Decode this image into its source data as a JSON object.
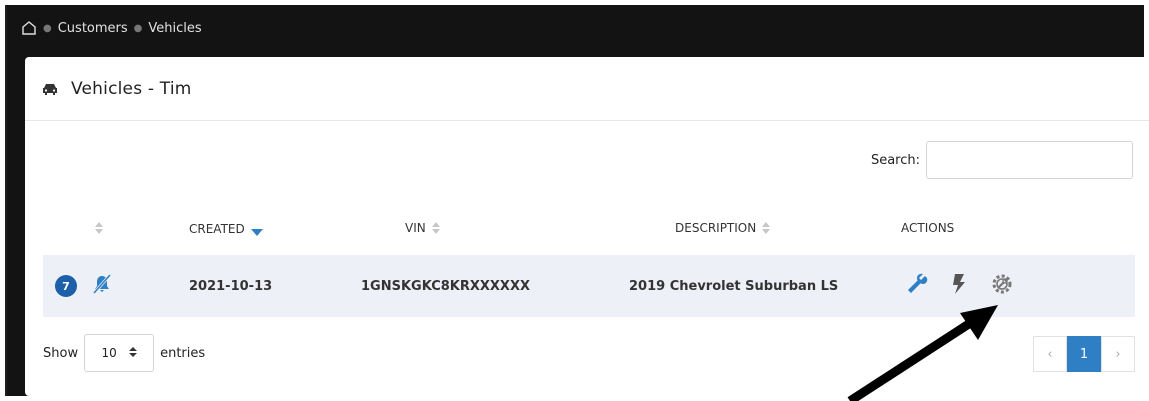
{
  "breadcrumb": {
    "icon": "home-icon",
    "items": [
      "Customers",
      "Vehicles"
    ]
  },
  "card": {
    "icon": "car-icon",
    "title": "Vehicles - Tim"
  },
  "search": {
    "label": "Search:",
    "value": "",
    "placeholder": ""
  },
  "table": {
    "columns": [
      "",
      "CREATED",
      "VIN",
      "DESCRIPTION",
      "ACTIONS"
    ],
    "rows": [
      {
        "badge": "7",
        "status_icon": "bell-slash-icon",
        "created": "2021-10-13",
        "vin": "1GNSKGKC8KRXXXXXX",
        "description": "2019 Chevrolet Suburban LS",
        "actions": [
          "wrench-icon",
          "bolt-icon",
          "gear-wrench-icon"
        ]
      }
    ]
  },
  "footer": {
    "show_label": "Show",
    "entries_value": "10",
    "entries_label": "entries",
    "pagination": {
      "prev": "‹",
      "current": "1",
      "next": "›"
    }
  },
  "colors": {
    "accent": "#2f7fc4",
    "badge": "#1d5fa8",
    "header_bg": "#131313",
    "row_bg": "#eef0f7"
  }
}
